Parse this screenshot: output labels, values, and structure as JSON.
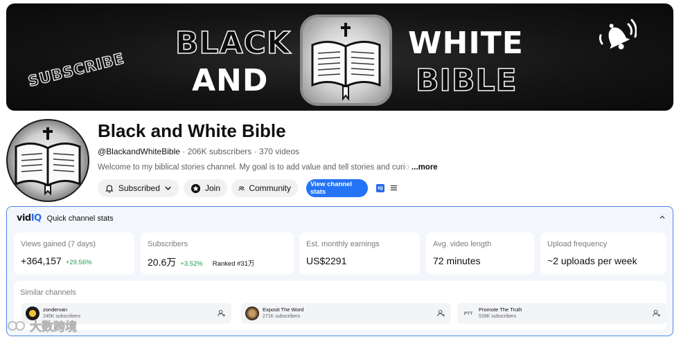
{
  "banner": {
    "subscribe_text": "SUBSCRIBE",
    "word_black": "BLACK",
    "word_and": "AND",
    "word_white": "WHITE",
    "word_bible": "BIBLE"
  },
  "channel": {
    "title": "Black and White Bible",
    "handle": "@BlackandWhiteBible",
    "meta": " · 206K subscribers · 370 videos",
    "description": "Welcome to my biblical stories channel. My goal is to add value and tell stories and curi",
    "description_fade": "o",
    "more_label": "...more"
  },
  "actions": {
    "subscribed_label": "Subscribed",
    "join_label": "Join",
    "community_label": "Community",
    "view_stats_label": "View channel stats",
    "iq_badge": "IQ"
  },
  "vidiq": {
    "logo_vid": "vid",
    "logo_iq": "IQ",
    "title": "Quick channel stats",
    "stats": {
      "views": {
        "label": "Views gained (7 days)",
        "value": "+364,157",
        "delta": "+29.56%"
      },
      "subscribers": {
        "label": "Subscribers",
        "value": "20.6万",
        "delta": "+3.52%",
        "rank": "Ranked #31万"
      },
      "earnings": {
        "label": "Est. monthly earnings",
        "value": "US$2291"
      },
      "video_length": {
        "label": "Avg. video length",
        "value": "72 minutes"
      },
      "upload_frequency": {
        "label": "Upload frequency",
        "value": "~2 uploads per week"
      }
    },
    "similar": {
      "title": "Similar channels",
      "channels": [
        {
          "name": "zondervan",
          "subs": "245K subscribers"
        },
        {
          "name": "Exposit The Word",
          "subs": "271K subscribers"
        },
        {
          "name": "Promote The Truth",
          "subs": "528K subscribers",
          "avatar_text": "PTT"
        }
      ]
    }
  },
  "watermark": {
    "text": "大数跨境"
  },
  "colors": {
    "accent_blue": "#2574f6",
    "positive_green": "#1f9d4c",
    "panel_border": "#4d86e6"
  }
}
